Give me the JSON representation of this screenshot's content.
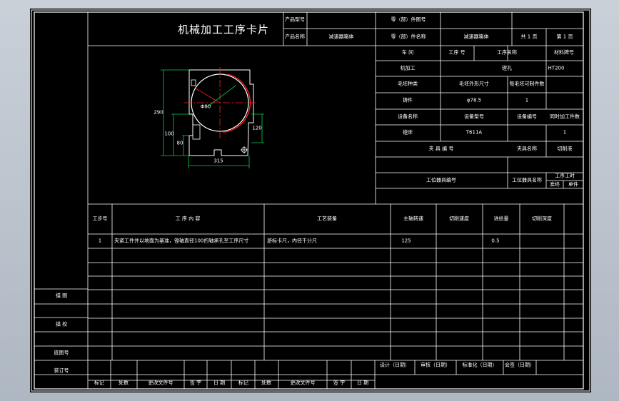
{
  "card": {
    "title": "机械加工工序卡片",
    "product_model_label": "产品型号",
    "product_name_label": "产品名称",
    "product_name": "减速器箱体",
    "part_drawing_no_label": "零（部）件图号",
    "part_name_label": "零（部）件名称",
    "part_name": "减速器箱体",
    "total_pages": "共 1 页",
    "page_no": "第 1 页"
  },
  "info": {
    "workshop_label": "车 间",
    "process_no_label": "工序 号",
    "process_name_label": "工序名称",
    "material_label": "材料牌号",
    "workshop": "机加工",
    "process_name": "镗孔",
    "material": "HT200",
    "blank_type_label": "毛坯种类",
    "blank_size_label": "毛坯外形尺寸",
    "parts_per_blank_label": "每毛坯可制件数",
    "blank_type": "铸件",
    "blank_size": "φ78.5",
    "parts_per_blank": "1",
    "equipment_name_label": "设备名称",
    "equipment_model_label": "设备型号",
    "equipment_no_label": "设备编号",
    "simultaneous_parts_label": "同时加工件数",
    "equipment_name": "镗床",
    "equipment_model": "T611A",
    "simultaneous_parts": "1",
    "fixture_no_label": "夹 具 编 号",
    "fixture_name_label": "夹具名称",
    "coolant_label": "切削液",
    "station_tool_no_label": "工位器具编号",
    "station_tool_name_label": "工位器具名称",
    "process_hours_label": "工序工时",
    "prep_label": "准终",
    "unit_label": "单件"
  },
  "drawing": {
    "dims": [
      "290",
      "100",
      "80",
      "120",
      "315",
      "Φ80"
    ]
  },
  "steps": {
    "headers": [
      "工步号",
      "工 序 内 容",
      "工艺装备",
      "主轴转速",
      "切削速度",
      "进给量",
      "切削深度"
    ],
    "rows": [
      {
        "no": "1",
        "content": "夹紧工件并以地面为基准，镗轴直径100的轴承孔至工序尺寸",
        "equipment": "游标卡尺，内径千分尺",
        "spindle_speed": "125",
        "cutting_speed": "",
        "feed": "0.5",
        "depth": ""
      }
    ]
  },
  "side": {
    "trace_label": "描 图",
    "check_label": "描 校",
    "base_no_label": "底图号",
    "binding_no_label": "装订号"
  },
  "footer": {
    "sign_labels": [
      "设计（日期）",
      "审核（日期）",
      "标准化（日期）",
      "会签（日期）"
    ],
    "revision_labels": [
      "标记",
      "处数",
      "更改文件号",
      "签 字",
      "日 期",
      "标记",
      "处数",
      "更改文件号",
      "签 字",
      "日 期"
    ]
  },
  "colors": {
    "background": "#000000",
    "lines": "#ffffff",
    "drawing_outline": "#ffffff",
    "dimension": "#00d24a",
    "center_line": "#ff2020",
    "hidden_bore": "#ff2020",
    "window": "#b7c0cb"
  }
}
